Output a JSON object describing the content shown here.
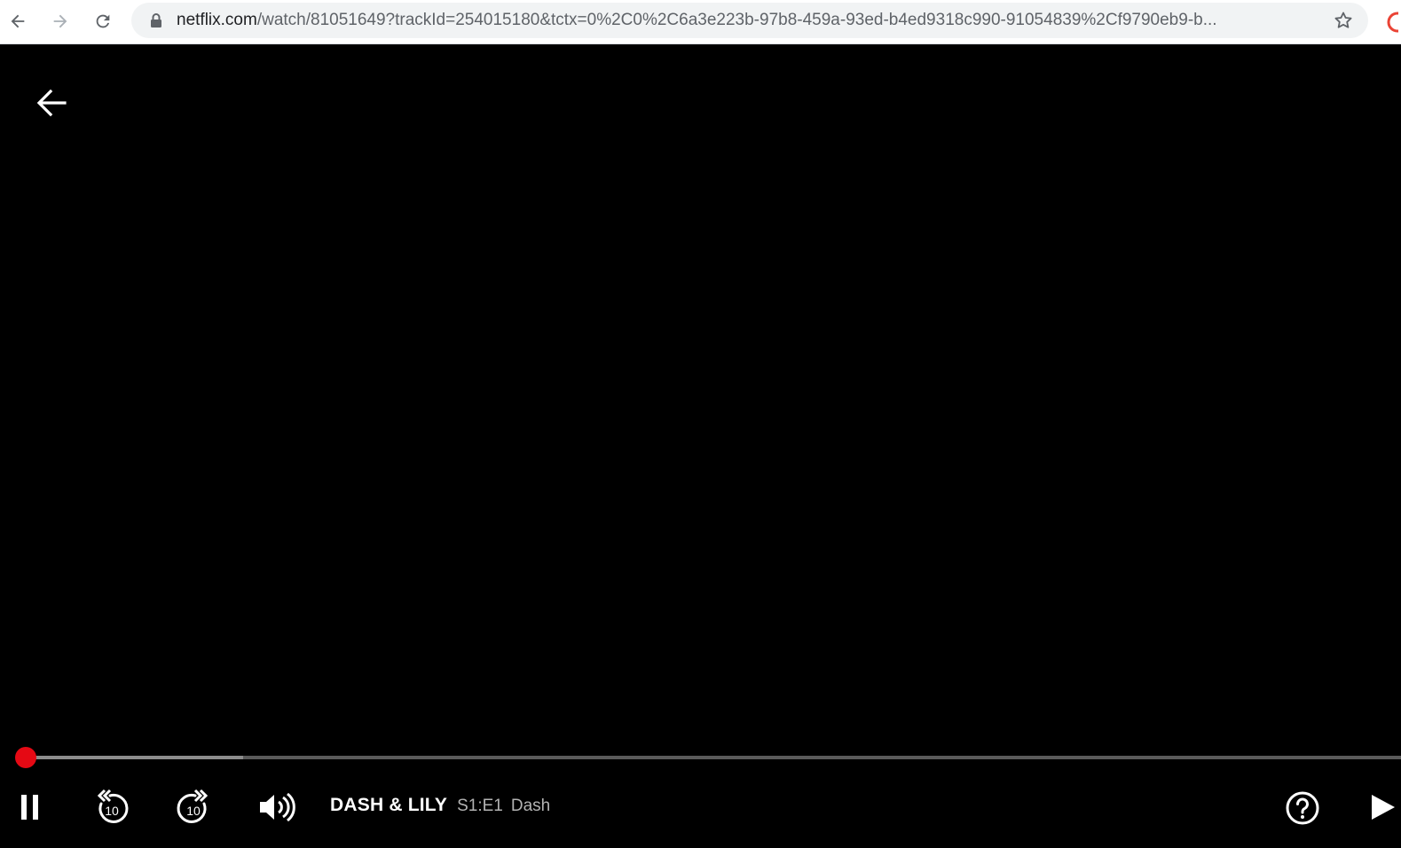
{
  "browser": {
    "url_host": "netflix.com",
    "url_rest": "/watch/81051649?trackId=254015180&tctx=0%2C0%2C6a3e223b-97b8-459a-93ed-b4ed9318c990-91054839%2Cf9790eb9-b..."
  },
  "player": {
    "show_title": "DASH & LILY",
    "episode_number": "S1:E1",
    "episode_title": "Dash",
    "progress_fraction": 0.007,
    "buffered_fraction": 0.164,
    "rewind_seconds": "10",
    "forward_seconds": "10"
  },
  "colors": {
    "accent": "#e50914",
    "background": "#000000"
  }
}
